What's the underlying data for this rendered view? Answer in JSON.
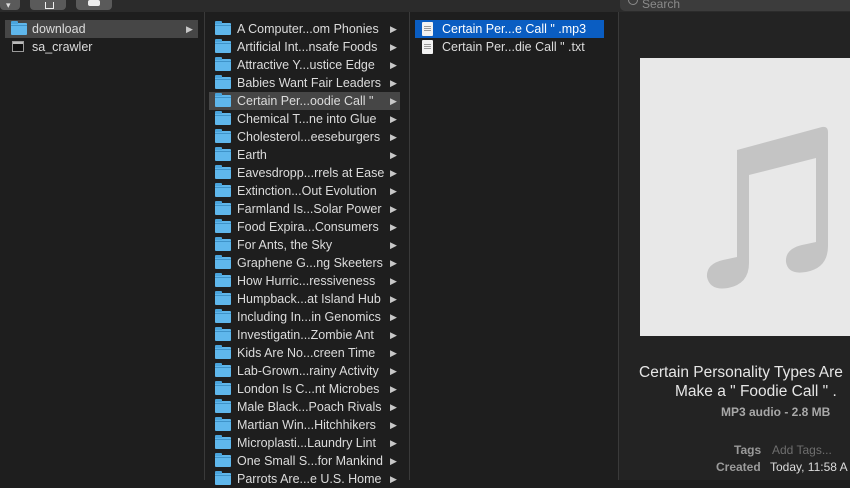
{
  "toolbar": {
    "search_placeholder": "Search"
  },
  "sidebar": {
    "items": [
      {
        "label": "download",
        "type": "folder",
        "selected": true
      },
      {
        "label": "sa_crawler",
        "type": "terminal",
        "selected": false
      }
    ]
  },
  "folders": [
    "A Computer...om Phonies",
    "Artificial Int...nsafe Foods",
    "Attractive Y...ustice Edge",
    "Babies Want Fair Leaders",
    "Certain Per...oodie Call \"",
    "Chemical T...ne into Glue",
    "Cholesterol...eeseburgers",
    "Earth",
    "Eavesdropp...rrels at Ease",
    "Extinction...Out Evolution",
    "Farmland Is...Solar Power",
    "Food Expira...Consumers",
    "For Ants, the Sky",
    "Graphene G...ng Skeeters",
    "How Hurric...ressiveness",
    "Humpback...at Island Hub",
    "Including In...in Genomics",
    "Investigatin...Zombie Ant",
    "Kids Are No...creen Time",
    "Lab-Grown...rainy Activity",
    "London Is C...nt Microbes",
    "Male Black...Poach Rivals",
    "Martian Win...Hitchhikers",
    "Microplasti...Laundry Lint",
    "One Small S...for Mankind",
    "Parrots Are...e U.S. Home"
  ],
  "folder_selected_index": 4,
  "files": [
    {
      "label": "Certain Per...e Call \" .mp3",
      "type": "audio",
      "selected": true
    },
    {
      "label": "Certain Per...die Call \" .txt",
      "type": "text",
      "selected": false
    }
  ],
  "preview": {
    "title_line1": "Certain Personality Types Are",
    "title_line2": "Make a  \" Foodie Call \" .",
    "kind_size": "MP3 audio - 2.8 MB",
    "tags_label": "Tags",
    "tags_placeholder": "Add Tags...",
    "created_label": "Created",
    "created_value": "Today, 11:58 A"
  },
  "colors": {
    "selection_blue": "#0a5dc2",
    "folder_blue": "#5fb7ec",
    "background": "#1e1e1e"
  }
}
